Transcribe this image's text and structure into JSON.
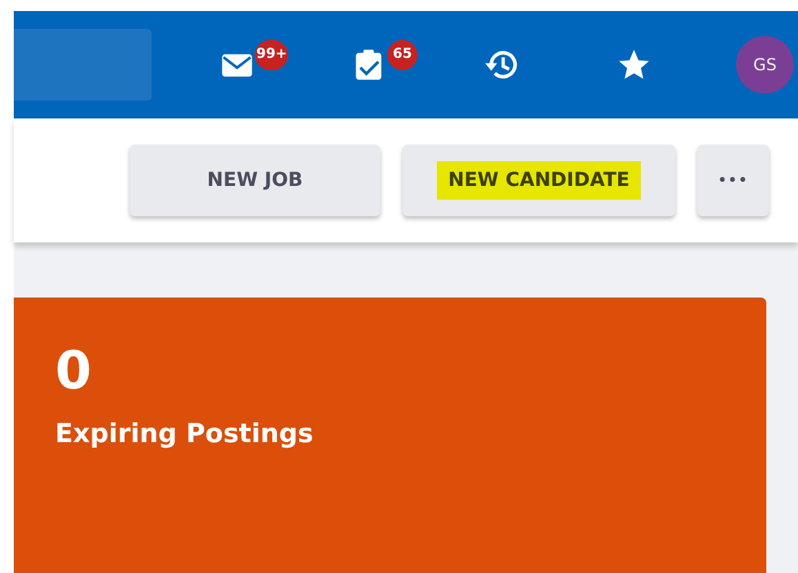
{
  "top_bar": {
    "icons": [
      {
        "kind": "mail",
        "badge": "99+"
      },
      {
        "kind": "tasks",
        "badge": "65"
      },
      {
        "kind": "history"
      },
      {
        "kind": "star"
      }
    ],
    "avatar": "GS"
  },
  "actions": [
    {
      "kind": "text",
      "label": "NEW JOB",
      "highlighted": false
    },
    {
      "kind": "text",
      "label": "NEW CANDIDATE",
      "highlighted": true
    },
    {
      "kind": "more",
      "label": "•••",
      "highlighted": false
    }
  ],
  "cards": [
    {
      "count": "0",
      "title": "Expiring Postings",
      "color": "#db4f0b"
    }
  ]
}
